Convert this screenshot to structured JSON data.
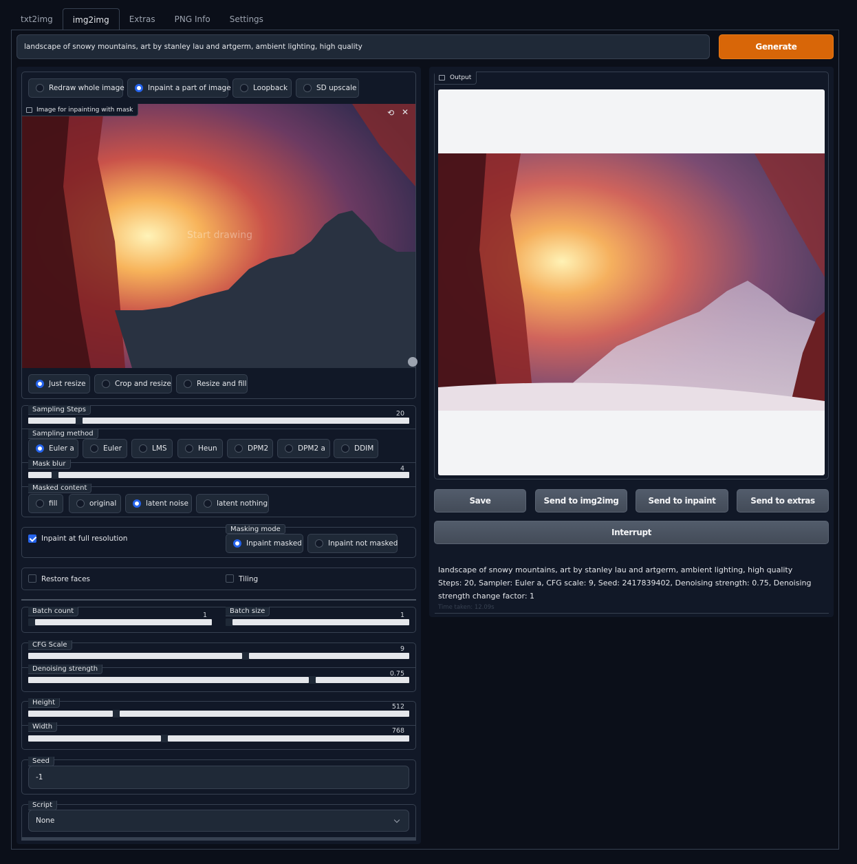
{
  "tabs": [
    "txt2img",
    "img2img",
    "Extras",
    "PNG Info",
    "Settings"
  ],
  "prompt": "landscape of snowy mountains, art by stanley lau and artgerm, ambient lighting, high quality",
  "generate_label": "Generate",
  "mode_options": [
    {
      "label": "Redraw whole image",
      "selected": false
    },
    {
      "label": "Inpaint a part of image",
      "selected": true
    },
    {
      "label": "Loopback",
      "selected": false
    },
    {
      "label": "SD upscale",
      "selected": false
    }
  ],
  "input_image": {
    "label": "Image for inpainting with mask",
    "overlay_text": "Start drawing"
  },
  "resize_options": [
    {
      "label": "Just resize",
      "selected": true
    },
    {
      "label": "Crop and resize",
      "selected": false
    },
    {
      "label": "Resize and fill",
      "selected": false
    }
  ],
  "sampling_steps": {
    "label": "Sampling Steps",
    "value": "20",
    "min": 1,
    "max": 150
  },
  "sampling_method": {
    "label": "Sampling method",
    "options": [
      {
        "label": "Euler a",
        "selected": true
      },
      {
        "label": "Euler",
        "selected": false
      },
      {
        "label": "LMS",
        "selected": false
      },
      {
        "label": "Heun",
        "selected": false
      },
      {
        "label": "DPM2",
        "selected": false
      },
      {
        "label": "DPM2 a",
        "selected": false
      },
      {
        "label": "DDIM",
        "selected": false
      }
    ]
  },
  "mask_blur": {
    "label": "Mask blur",
    "value": "4",
    "min": 0,
    "max": 64
  },
  "masked_content": {
    "label": "Masked content",
    "options": [
      {
        "label": "fill",
        "selected": false
      },
      {
        "label": "original",
        "selected": false
      },
      {
        "label": "latent noise",
        "selected": true
      },
      {
        "label": "latent nothing",
        "selected": false
      }
    ]
  },
  "inpaint_full_res": {
    "label": "Inpaint at full resolution",
    "checked": true
  },
  "masking_mode": {
    "label": "Masking mode",
    "options": [
      {
        "label": "Inpaint masked",
        "selected": true
      },
      {
        "label": "Inpaint not masked",
        "selected": false
      }
    ]
  },
  "restore_faces": {
    "label": "Restore faces",
    "checked": false
  },
  "tiling": {
    "label": "Tiling",
    "checked": false
  },
  "batch_count": {
    "label": "Batch count",
    "value": "1",
    "min": 1,
    "max": 16
  },
  "batch_size": {
    "label": "Batch size",
    "value": "1",
    "min": 1,
    "max": 8
  },
  "cfg_scale": {
    "label": "CFG Scale",
    "value": "9",
    "min": 1,
    "max": 15
  },
  "denoising_strength": {
    "label": "Denoising strength",
    "value": "0.75",
    "min": 0,
    "max": 1
  },
  "height": {
    "label": "Height",
    "value": "512",
    "min": 64,
    "max": 2048
  },
  "width": {
    "label": "Width",
    "value": "768",
    "min": 64,
    "max": 2048
  },
  "seed": {
    "label": "Seed",
    "value": "-1"
  },
  "script": {
    "label": "Script",
    "value": "None"
  },
  "output": {
    "label": "Output",
    "buttons": [
      "Save",
      "Send to img2img",
      "Send to inpaint",
      "Send to extras"
    ],
    "interrupt_label": "Interrupt",
    "info_prompt": "landscape of snowy mountains, art by stanley lau and artgerm, ambient lighting, high quality",
    "info_params": "Steps: 20, Sampler: Euler a, CFG scale: 9, Seed: 2417839402, Denoising strength: 0.75, Denoising strength change factor: 1",
    "time_taken": "Time taken: 12.09s"
  },
  "icons": [
    "image-icon",
    "undo-icon",
    "close-icon",
    "chevron-down-icon"
  ],
  "colors": {
    "accent": "#2563eb",
    "generate": "#d86608",
    "background": "#0b0f19",
    "panel": "#111827"
  }
}
